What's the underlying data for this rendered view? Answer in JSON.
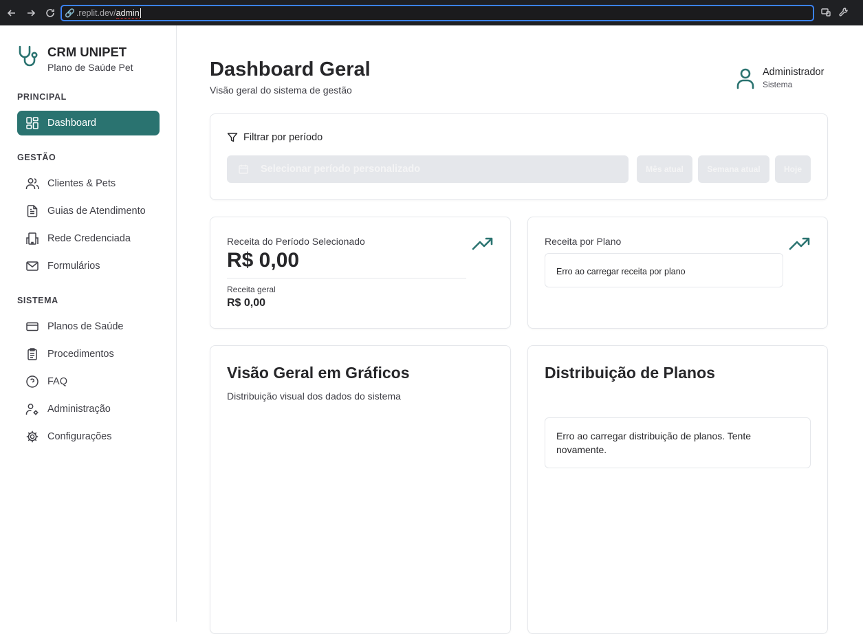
{
  "browser": {
    "url_host": ".replit.dev/",
    "url_path": "admin",
    "icons": [
      "back-icon",
      "forward-icon",
      "reload-icon",
      "site-info-icon",
      "cast-icon",
      "tools-icon"
    ]
  },
  "sidebar": {
    "brand_title": "CRM UNIPET",
    "brand_subtitle": "Plano de Saúde Pet",
    "sections": [
      {
        "label": "PRINCIPAL",
        "items": [
          {
            "label": "Dashboard",
            "icon": "dashboard-grid-icon",
            "active": true
          }
        ]
      },
      {
        "label": "GESTÃO",
        "items": [
          {
            "label": "Clientes & Pets",
            "icon": "users-icon"
          },
          {
            "label": "Guias de Atendimento",
            "icon": "file-text-icon"
          },
          {
            "label": "Rede Credenciada",
            "icon": "building-icon"
          },
          {
            "label": "Formulários",
            "icon": "mail-icon"
          }
        ]
      },
      {
        "label": "SISTEMA",
        "items": [
          {
            "label": "Planos de Saúde",
            "icon": "credit-card-icon"
          },
          {
            "label": "Procedimentos",
            "icon": "clipboard-icon"
          },
          {
            "label": "FAQ",
            "icon": "help-circle-icon"
          },
          {
            "label": "Administração",
            "icon": "user-cog-icon"
          },
          {
            "label": "Configurações",
            "icon": "gear-icon"
          }
        ]
      }
    ]
  },
  "header": {
    "title": "Dashboard Geral",
    "subtitle": "Visão geral do sistema de gestão",
    "user_name": "Administrador",
    "user_role": "Sistema"
  },
  "filter": {
    "title": "Filtrar por período",
    "placeholder": "Selecionar período personalizado",
    "chips": [
      "Mês atual",
      "Semana atual",
      "Hoje"
    ]
  },
  "revenue": {
    "label": "Receita do Período Selecionado",
    "value": "R$ 0,00",
    "general_label": "Receita geral",
    "general_value": "R$ 0,00"
  },
  "revenue_by_plan": {
    "label": "Receita por Plano",
    "error": "Erro ao carregar receita por plano"
  },
  "charts_overview": {
    "title": "Visão Geral em Gráficos",
    "description": "Distribuição visual dos dados do sistema"
  },
  "plan_distribution": {
    "title": "Distribuição de Planos",
    "error": "Erro ao carregar distribuição de planos. Tente novamente."
  },
  "colors": {
    "accent": "#2a7370",
    "border": "#e5e7eb",
    "chip_bg": "#e5e7eb"
  }
}
